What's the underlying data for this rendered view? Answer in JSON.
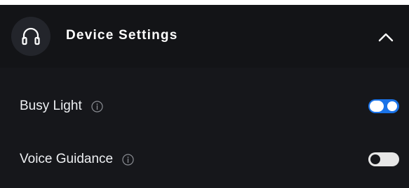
{
  "panel": {
    "title": "Device Settings",
    "expanded": true,
    "header_icon": "headphones-icon",
    "collapse_icon": "chevron-up-icon"
  },
  "settings": [
    {
      "label": "Busy Light",
      "info_icon": "info-icon",
      "enabled": true
    },
    {
      "label": "Voice Guidance",
      "info_icon": "info-icon",
      "enabled": false
    }
  ],
  "colors": {
    "background": "#16171b",
    "header_background": "#131417",
    "accent": "#1a73e8",
    "text": "#eef0f3"
  }
}
